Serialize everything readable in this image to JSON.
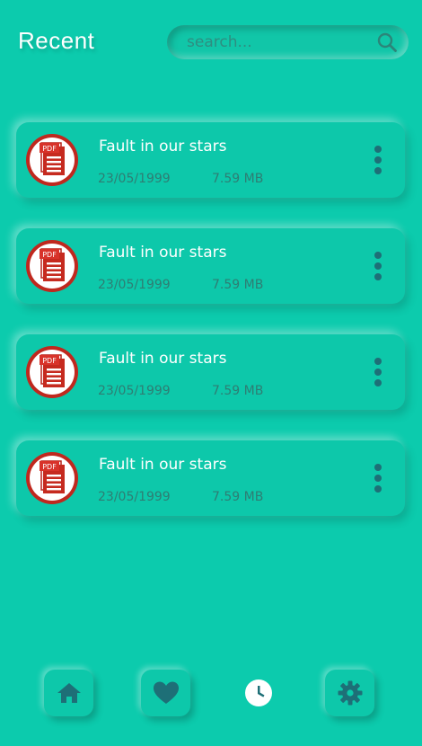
{
  "header": {
    "title": "Recent"
  },
  "search": {
    "placeholder": "search..."
  },
  "files": [
    {
      "name": "Fault in our stars",
      "date": "23/05/1999",
      "size": "7.59 MB",
      "icon": "pdf-icon"
    },
    {
      "name": "Fault in our stars",
      "date": "23/05/1999",
      "size": "7.59 MB",
      "icon": "pdf-icon"
    },
    {
      "name": "Fault in our stars",
      "date": "23/05/1999",
      "size": "7.59 MB",
      "icon": "pdf-icon"
    },
    {
      "name": "Fault in our stars",
      "date": "23/05/1999",
      "size": "7.59 MB",
      "icon": "pdf-icon"
    }
  ],
  "nav": [
    {
      "icon": "home-icon",
      "active": false
    },
    {
      "icon": "heart-icon",
      "active": false
    },
    {
      "icon": "clock-icon",
      "active": true
    },
    {
      "icon": "settings-icon",
      "active": false
    }
  ],
  "colors": {
    "background": "#0ccbad",
    "icon": "#1e6f77",
    "pdf_red": "#c0281e",
    "text_primary": "#ffffff",
    "text_secondary": "#2f7d73"
  }
}
